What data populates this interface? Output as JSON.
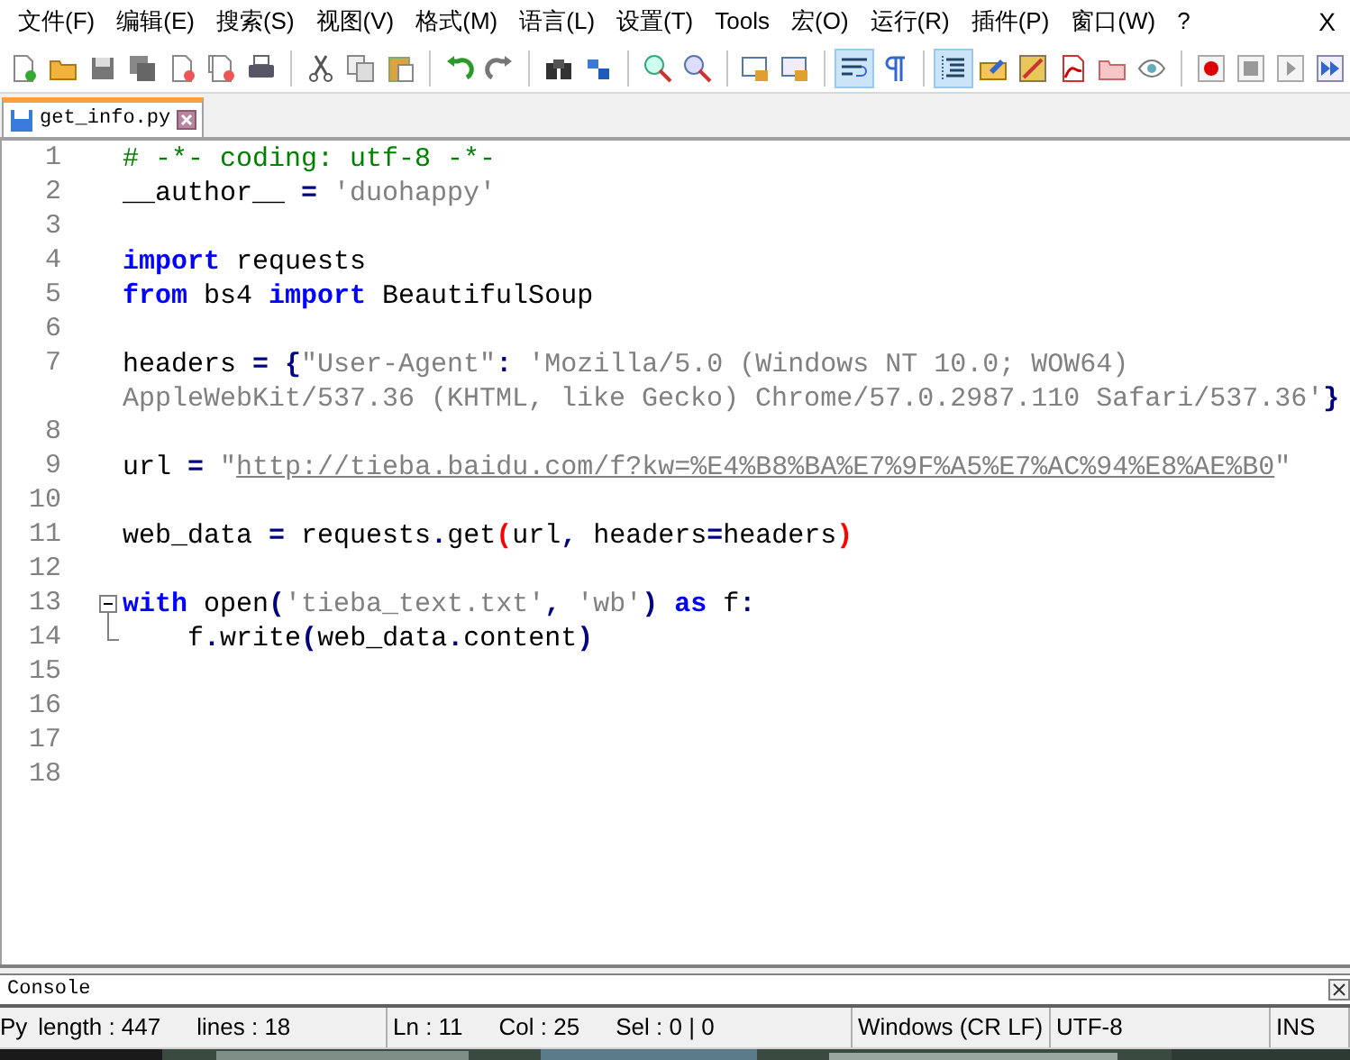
{
  "menu_bar": {
    "items": [
      "文件(F)",
      "编辑(E)",
      "搜索(S)",
      "视图(V)",
      "格式(M)",
      "语言(L)",
      "设置(T)",
      "Tools",
      "宏(O)",
      "运行(R)",
      "插件(P)",
      "窗口(W)",
      "?"
    ],
    "close": "X"
  },
  "toolbar": [
    {
      "pressed": false
    },
    {
      "pressed": false
    },
    {
      "pressed": false
    },
    {
      "pressed": false
    },
    {
      "pressed": false
    },
    {
      "pressed": false
    },
    {
      "pressed": false
    },
    {
      "pressed": false
    },
    {
      "pressed": false
    },
    {
      "pressed": false
    },
    {
      "pressed": false
    },
    {
      "pressed": false
    },
    {
      "pressed": false
    },
    {
      "pressed": false
    },
    {
      "pressed": false
    },
    {
      "pressed": false
    },
    {
      "pressed": false
    },
    {
      "pressed": false
    },
    {
      "pressed": true
    },
    {
      "pressed": false
    },
    {
      "pressed": true
    },
    {
      "pressed": false
    },
    {
      "pressed": false
    },
    {
      "pressed": false
    },
    {
      "pressed": false
    },
    {
      "pressed": false
    },
    {
      "pressed": false
    },
    {
      "pressed": false
    },
    {
      "pressed": false
    },
    {
      "pressed": false
    }
  ],
  "tabs": [
    {
      "label": "get_info.py",
      "selected": true
    }
  ],
  "editor": {
    "lines": [
      {
        "number": "1",
        "kind": "plain",
        "rows": [
          {
            "tokens": [
              {
                "kind": "comment",
                "text": "# -*- coding: utf-8 -*-"
              }
            ]
          }
        ]
      },
      {
        "number": "2",
        "kind": "plain",
        "rows": [
          {
            "tokens": [
              {
                "kind": "name",
                "text": "__author__ "
              },
              {
                "kind": "operator",
                "text": "="
              },
              {
                "kind": "string",
                "text": " 'duohappy'"
              }
            ]
          }
        ]
      },
      {
        "number": "3",
        "kind": "plain"
      },
      {
        "number": "4",
        "kind": "plain",
        "rows": [
          {
            "tokens": [
              {
                "kind": "keyword",
                "text": "import"
              },
              {
                "kind": "name",
                "text": " requests"
              }
            ]
          }
        ]
      },
      {
        "number": "5",
        "kind": "plain",
        "rows": [
          {
            "tokens": [
              {
                "kind": "keyword",
                "text": "from"
              },
              {
                "kind": "name",
                "text": " bs4 "
              },
              {
                "kind": "keyword",
                "text": "import"
              },
              {
                "kind": "name",
                "text": " BeautifulSoup"
              }
            ]
          }
        ]
      },
      {
        "number": "6",
        "kind": "plain"
      },
      {
        "number": "7",
        "kind": "plain",
        "rows": [
          {
            "tokens": [
              {
                "kind": "name",
                "text": "headers "
              },
              {
                "kind": "operator",
                "text": "= {"
              },
              {
                "kind": "string",
                "text": "\"User-Agent\""
              },
              {
                "kind": "operator",
                "text": ":"
              },
              {
                "kind": "string",
                "text": " 'Mozilla/5.0 (Windows NT 10.0; WOW64)"
              }
            ]
          },
          {
            "tokens": [
              {
                "kind": "string",
                "text": "AppleWebKit/537.36 (KHTML, like Gecko) Chrome/57.0.2987.110 Safari/537.36'"
              },
              {
                "kind": "operator",
                "text": "}"
              }
            ]
          }
        ]
      },
      {
        "number": "8",
        "kind": "plain"
      },
      {
        "number": "9",
        "kind": "plain",
        "rows": [
          {
            "tokens": [
              {
                "kind": "name",
                "text": "url "
              },
              {
                "kind": "operator",
                "text": "="
              },
              {
                "kind": "string",
                "text": " \""
              },
              {
                "kind": "link",
                "text": "http://tieba.baidu.com/f?kw=%E4%B8%BA%E7%9F%A5%E7%AC%94%E8%AE%B0"
              },
              {
                "kind": "string",
                "text": "\""
              }
            ]
          }
        ]
      },
      {
        "number": "10",
        "kind": "plain"
      },
      {
        "number": "11",
        "kind": "plain",
        "rows": [
          {
            "tokens": [
              {
                "kind": "name",
                "text": "web_data "
              },
              {
                "kind": "operator",
                "text": "="
              },
              {
                "kind": "name",
                "text": " requests"
              },
              {
                "kind": "operator",
                "text": "."
              },
              {
                "kind": "name",
                "text": "get"
              },
              {
                "kind": "brace_match",
                "text": "("
              },
              {
                "kind": "name",
                "text": "url"
              },
              {
                "kind": "operator",
                "text": ","
              },
              {
                "kind": "name",
                "text": " headers"
              },
              {
                "kind": "operator",
                "text": "="
              },
              {
                "kind": "name",
                "text": "headers"
              },
              {
                "kind": "brace_match",
                "text": ")"
              }
            ]
          }
        ]
      },
      {
        "number": "12",
        "kind": "plain"
      },
      {
        "number": "13",
        "kind": "fold_start",
        "rows": [
          {
            "tokens": [
              {
                "kind": "keyword",
                "text": "with"
              },
              {
                "kind": "name",
                "text": " open"
              },
              {
                "kind": "operator",
                "text": "("
              },
              {
                "kind": "string",
                "text": "'tieba_text.txt'"
              },
              {
                "kind": "operator",
                "text": ","
              },
              {
                "kind": "string",
                "text": " 'wb'"
              },
              {
                "kind": "operator",
                "text": ")"
              },
              {
                "kind": "keyword",
                "text": " as"
              },
              {
                "kind": "name",
                "text": " f"
              },
              {
                "kind": "operator",
                "text": ":"
              }
            ]
          }
        ]
      },
      {
        "number": "14",
        "kind": "fold_end",
        "rows": [
          {
            "tokens": [
              {
                "kind": "name",
                "text": "    f"
              },
              {
                "kind": "operator",
                "text": "."
              },
              {
                "kind": "name",
                "text": "write"
              },
              {
                "kind": "operator",
                "text": "("
              },
              {
                "kind": "name",
                "text": "web_data"
              },
              {
                "kind": "operator",
                "text": "."
              },
              {
                "kind": "name",
                "text": "content"
              },
              {
                "kind": "operator",
                "text": ")"
              }
            ]
          }
        ]
      },
      {
        "number": "15",
        "kind": "plain"
      },
      {
        "number": "16",
        "kind": "plain"
      },
      {
        "number": "17",
        "kind": "plain"
      },
      {
        "number": "18",
        "kind": "plain"
      }
    ]
  },
  "console": {
    "title": "Console"
  },
  "status_bar": [
    "Py",
    "length : 447",
    "lines : 18",
    "Ln : 11",
    "Col : 25",
    "Sel : 0 | 0",
    "Windows (CR LF)",
    "UTF-8",
    "INS"
  ]
}
